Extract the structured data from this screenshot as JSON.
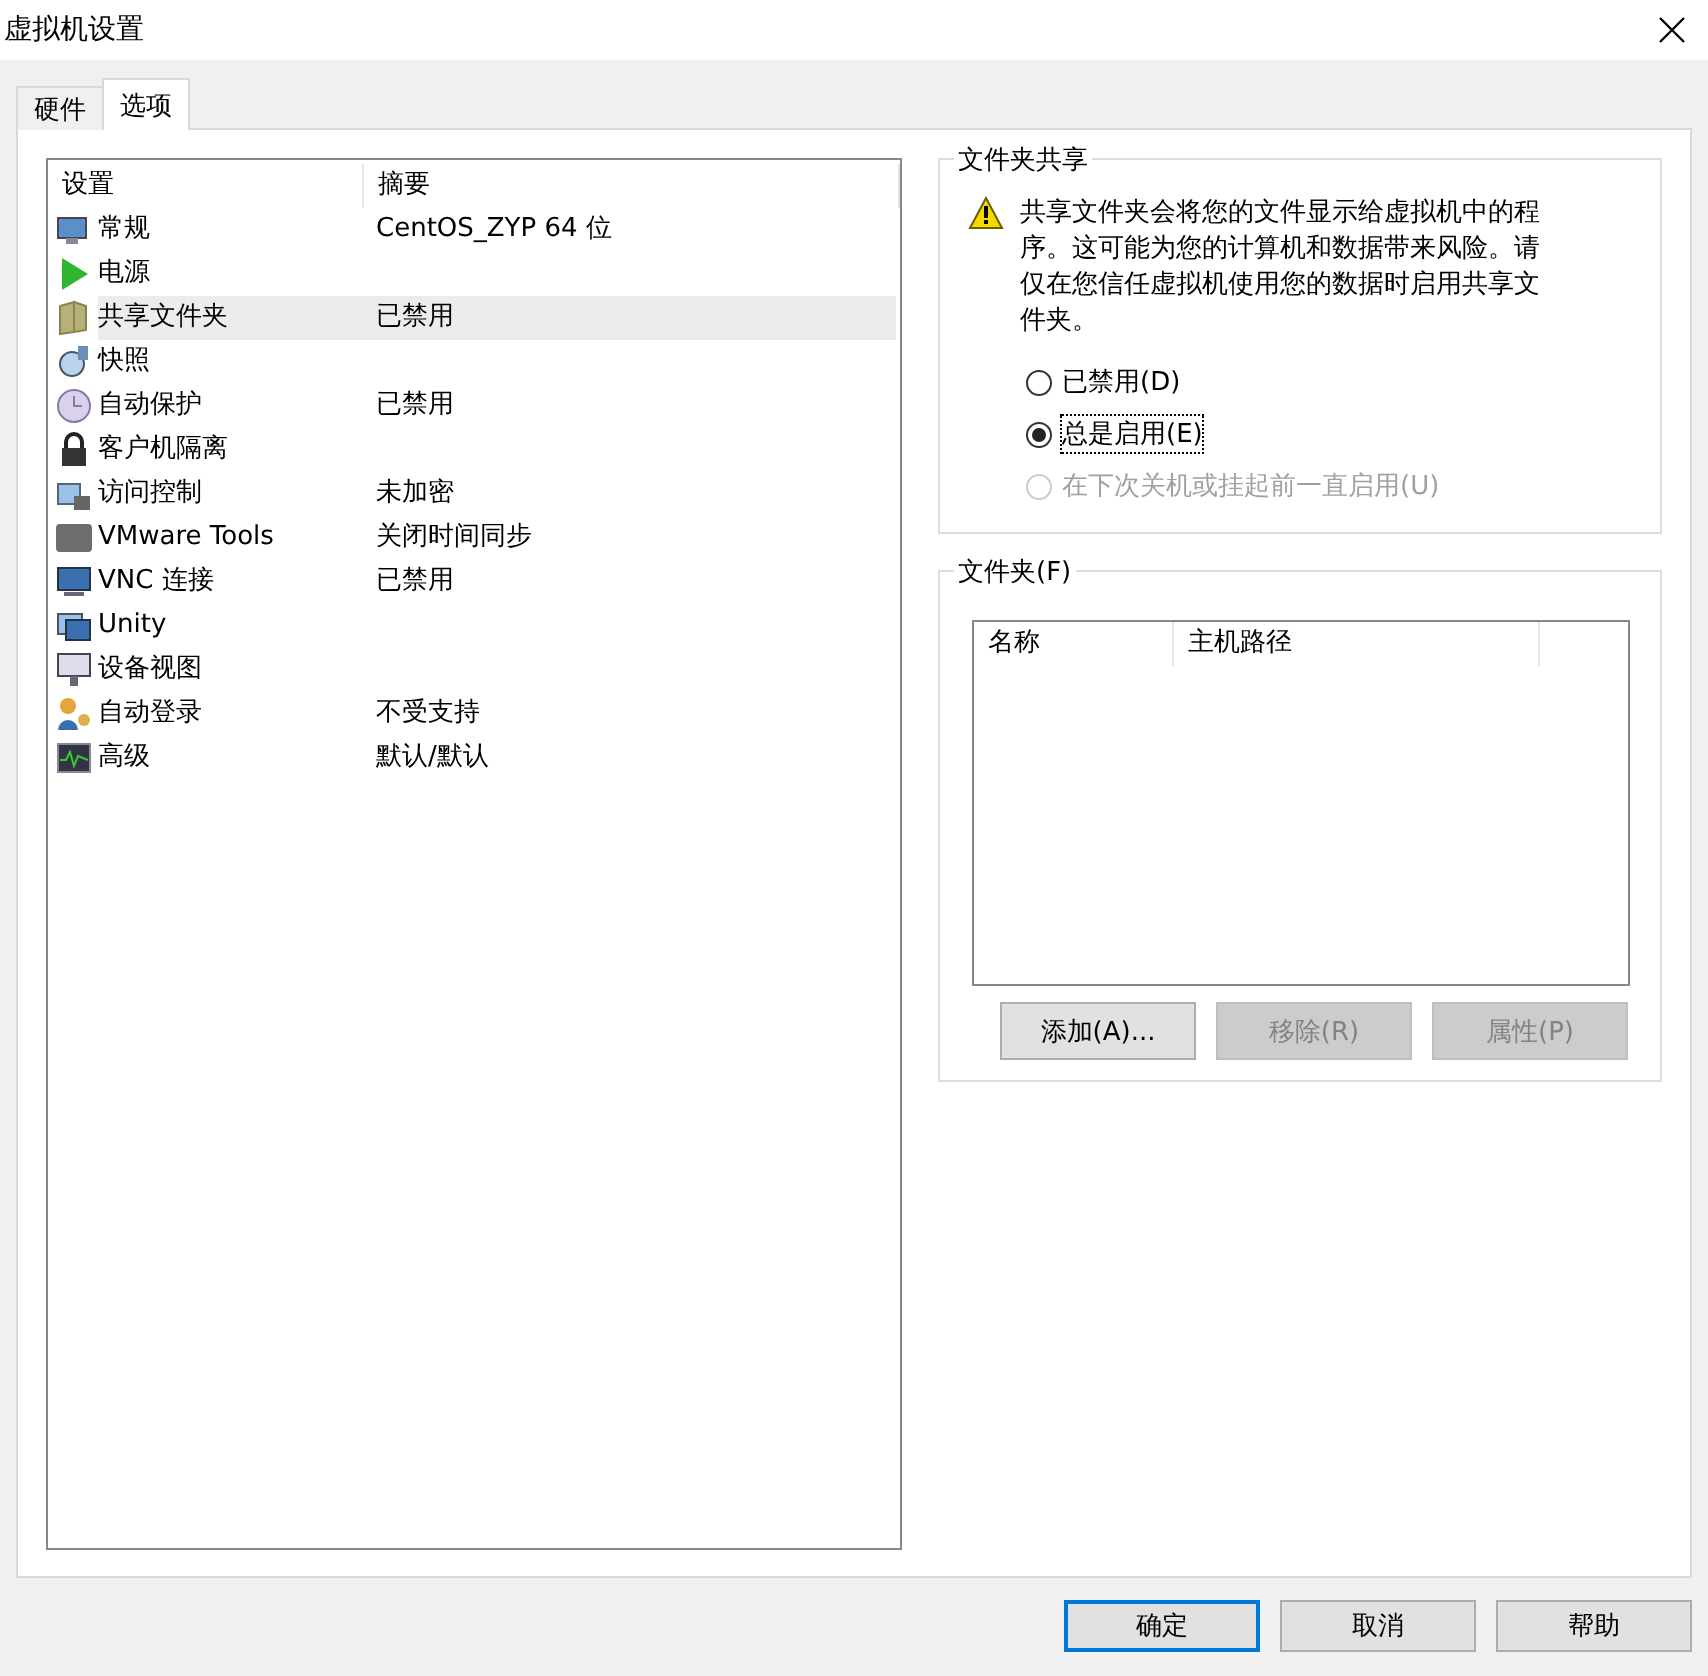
{
  "window": {
    "title": "虚拟机设置"
  },
  "tabs": [
    {
      "label": "硬件",
      "selected": false
    },
    {
      "label": "选项",
      "selected": true
    }
  ],
  "settings": {
    "columns": [
      "设置",
      "摘要"
    ],
    "rows": [
      {
        "name": "常规",
        "summary": "CentOS_ZYP 64 位",
        "selected": false
      },
      {
        "name": "电源",
        "selected": false
      },
      {
        "name": "共享文件夹",
        "summary": "已禁用",
        "selected": true
      },
      {
        "name": "快照",
        "selected": false
      },
      {
        "name": "自动保护",
        "summary": "已禁用",
        "selected": false
      },
      {
        "name": "客户机隔离",
        "selected": false
      },
      {
        "name": "访问控制",
        "summary": "未加密",
        "selected": false
      },
      {
        "name": "VMware Tools",
        "summary": "关闭时间同步",
        "selected": false
      },
      {
        "name": "VNC 连接",
        "summary": "已禁用",
        "selected": false
      },
      {
        "name": "Unity",
        "selected": false
      },
      {
        "name": "设备视图",
        "selected": false
      },
      {
        "name": "自动登录",
        "summary": "不受支持",
        "selected": false
      },
      {
        "name": "高级",
        "summary": "默认/默认",
        "selected": false
      }
    ]
  },
  "sharing": {
    "title": "文件夹共享",
    "warning": "共享文件夹会将您的文件显示给虚拟机中的程序。这可能为您的计算机和数据带来风险。请仅在您信任虚拟机使用您的数据时启用共享文件夹。",
    "options": [
      {
        "label": "已禁用(D)",
        "selected": false,
        "disabled": false
      },
      {
        "label": "总是启用(E)",
        "selected": true,
        "disabled": false
      },
      {
        "label": "在下次关机或挂起前一直启用(U)",
        "selected": false,
        "disabled": true
      }
    ]
  },
  "folders": {
    "title": "文件夹(F)",
    "columns": [
      "名称",
      "主机路径"
    ],
    "buttons": [
      {
        "label": "添加(A)...",
        "disabled": false
      },
      {
        "label": "移除(R)",
        "disabled": true
      },
      {
        "label": "属性(P)",
        "disabled": true
      }
    ]
  },
  "buttons": [
    {
      "label": "确定",
      "default": true
    },
    {
      "label": "取消",
      "default": false
    },
    {
      "label": "帮助",
      "default": false
    }
  ]
}
